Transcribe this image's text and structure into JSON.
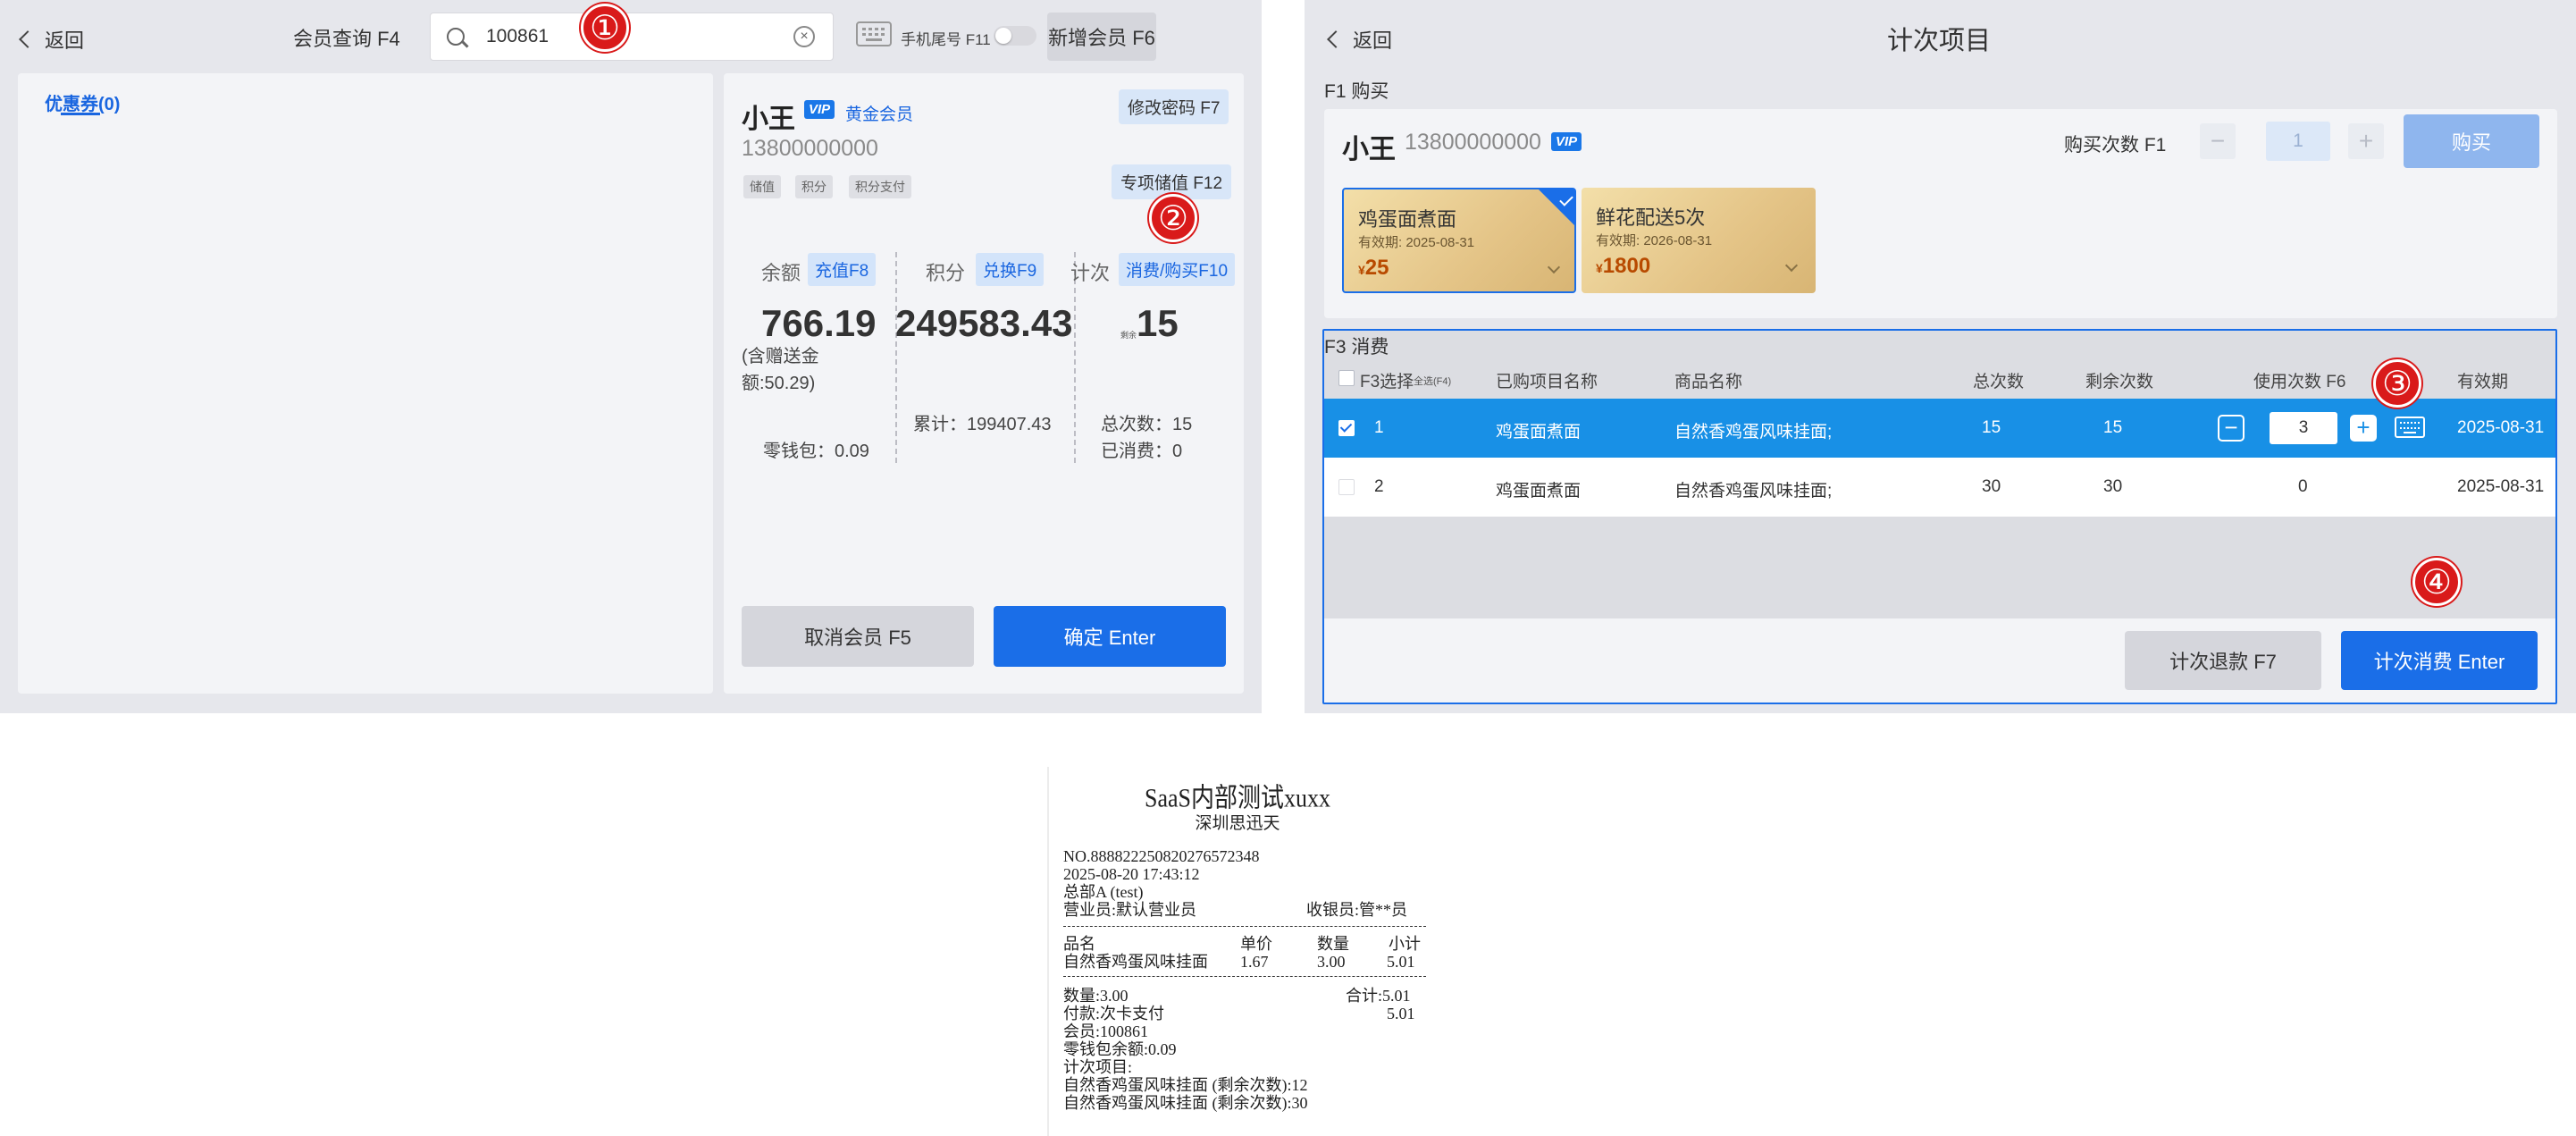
{
  "left": {
    "back_label": "返回",
    "title": "会员查询 F4",
    "search_value": "100861",
    "phone_tail_label": "手机尾号 F11",
    "new_member_label": "新增会员 F6",
    "coupons_tab": "优惠券(0)",
    "member": {
      "name": "小王",
      "vip": "VIP",
      "level": "黄金会员",
      "phone": "13800000000",
      "tags": [
        "储值",
        "积分",
        "积分支付"
      ],
      "change_password": "修改密码 F7",
      "special_stored_value": "专项储值 F12"
    },
    "stats": {
      "balance_label": "余额",
      "recharge_btn": "充值F8",
      "balance": "766.19",
      "gift_amount": "(含赠送金额:50.29)",
      "wallet": "零钱包：0.09",
      "points_label": "积分",
      "redeem_btn": "兑换F9",
      "points": "249583.43",
      "points_total": "累计：199407.43",
      "count_label": "计次",
      "count_btn": "消费/购买F10",
      "count_prefix": "剩余",
      "count_value": "15",
      "count_total": "总次数：15",
      "count_used": "已消费：0"
    },
    "cancel_label": "取消会员 F5",
    "confirm_label": "确定 Enter"
  },
  "right": {
    "back_label": "返回",
    "title": "计次项目",
    "buy_section": "F1 购买",
    "member_name": "小王",
    "member_phone": "13800000000",
    "vip": "VIP",
    "buy_count_label": "购买次数 F1",
    "buy_qty": "1",
    "buy_label": "购买",
    "cards": [
      {
        "title": "鸡蛋面煮面",
        "exp": "有效期: 2025-08-31",
        "currency": "¥",
        "price": "25"
      },
      {
        "title": "鲜花配送5次",
        "exp": "有效期: 2026-08-31",
        "currency": "¥",
        "price": "1800"
      }
    ],
    "consume_section": "F3 消费",
    "headers": {
      "select": "F3选择",
      "select_all": "全选(F4)",
      "project": "已购项目名称",
      "product": "商品名称",
      "total": "总次数",
      "remaining": "剩余次数",
      "use": "使用次数 F6",
      "expiry": "有效期"
    },
    "rows": [
      {
        "no": "1",
        "project": "鸡蛋面煮面",
        "product": "自然香鸡蛋风味挂面;",
        "total": "15",
        "remaining": "15",
        "use": "3",
        "expiry": "2025-08-31"
      },
      {
        "no": "2",
        "project": "鸡蛋面煮面",
        "product": "自然香鸡蛋风味挂面;",
        "total": "30",
        "remaining": "30",
        "use": "0",
        "expiry": "2025-08-31"
      }
    ],
    "refund_label": "计次退款 F7",
    "consume_label": "计次消费 Enter"
  },
  "receipt": {
    "title": "SaaS内部测试xuxx",
    "subtitle": "深圳思迅天",
    "no": "NO.888822250820276572348",
    "datetime": "2025-08-20 17:43:12",
    "store": "总部A (test)",
    "salesperson": "营业员:默认营业员",
    "cashier": "收银员:管**员",
    "col_name": "品名",
    "col_price": "单价",
    "col_qty": "数量",
    "col_subtotal": "小计",
    "item_name": "自然香鸡蛋风味挂面",
    "item_price": "1.67",
    "item_qty": "3.00",
    "item_subtotal": "5.01",
    "qty_total": "数量:3.00",
    "sum_total": "合计:5.01",
    "payment": "付款:次卡支付",
    "payment_amount": "5.01",
    "member": "会员:100861",
    "wallet": "零钱包余额:0.09",
    "count_items": "计次项目:",
    "remaining_1": "自然香鸡蛋风味挂面 (剩余次数):12",
    "remaining_2": "自然香鸡蛋风味挂面 (剩余次数):30"
  },
  "markers": [
    "①",
    "②",
    "③",
    "④"
  ],
  "colors": {
    "primary": "#1a6ee8",
    "selected_row": "#1890e6",
    "marker": "#d91a1a",
    "card_gold": "#e4c487"
  }
}
